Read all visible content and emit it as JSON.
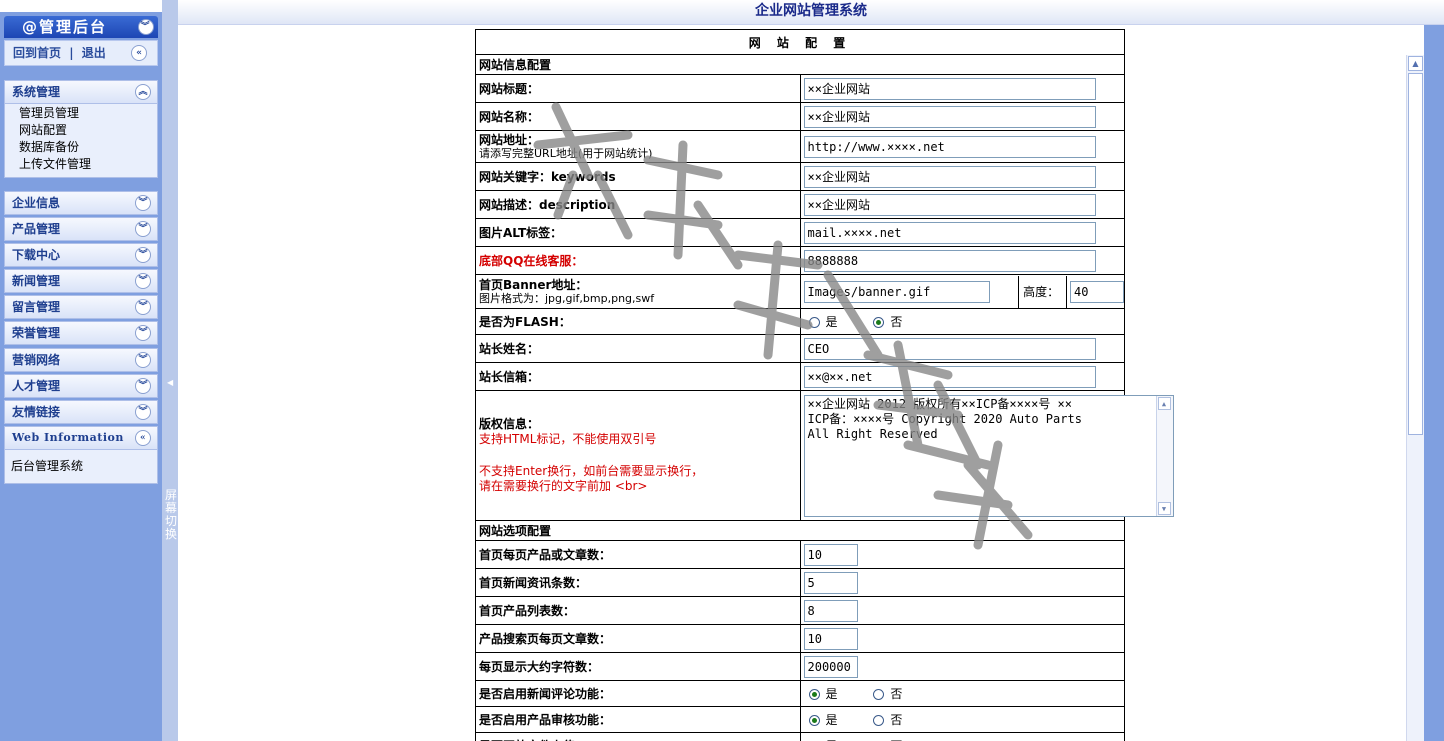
{
  "window": {
    "title": "企业网站管理系统"
  },
  "sidebar": {
    "title": "@管理后台",
    "top_links": [
      "回到首页",
      "|",
      "退出"
    ],
    "system_menu": {
      "label": "系统管理",
      "items": [
        "管理员管理",
        "网站配置",
        "数据库备份",
        "上传文件管理"
      ]
    },
    "menus": [
      "企业信息",
      "产品管理",
      "下载中心",
      "新闻管理",
      "留言管理",
      "荣誉管理",
      "营销网络",
      "人才管理",
      "友情链接"
    ],
    "web_info": {
      "label": "Web Information",
      "text": "后台管理系统"
    },
    "split_toggle": "屏幕切换"
  },
  "config": {
    "header": "网 站 配 置",
    "section_site": "网站信息配置",
    "section_options": "网站选项配置",
    "site_title": {
      "label": "网站标题：",
      "value": "××企业网站"
    },
    "site_name": {
      "label": "网站名称：",
      "value": "××企业网站"
    },
    "site_url": {
      "label": "网站地址：",
      "hint": "请添写完整URL地址(用于网站统计)",
      "value": "http://www.××××.net"
    },
    "keywords": {
      "label": "网站关键字：keywords",
      "value": "××企业网站"
    },
    "description": {
      "label": "网站描述：description",
      "value": "××企业网站"
    },
    "img_alt": {
      "label": "图片ALT标签：",
      "value": "mail.××××.net"
    },
    "qq": {
      "label": "底部QQ在线客服：",
      "value": "8888888"
    },
    "banner": {
      "label": "首页Banner地址：",
      "hint": "图片格式为：jpg,gif,bmp,png,swf",
      "value": "Images/banner.gif",
      "height_label": "高度：",
      "height_value": "40"
    },
    "is_flash": {
      "label": "是否为FLASH：",
      "yes": "是",
      "no": "否"
    },
    "admin_name": {
      "label": "站长姓名：",
      "value": "CEO"
    },
    "admin_email": {
      "label": "站长信箱：",
      "value": "××@××.net"
    },
    "copyright": {
      "label": "版权信息：",
      "hint1": "支持HTML标记，不能使用双引号",
      "hint2": "不支持Enter换行，如前台需要显示换行，",
      "hint3": "请在需要换行的文字前加 <br>",
      "line1": "××企业网站 2012 版权所有××ICP备××××号 ××",
      "line2": "ICP备：××××号 Copyright 2020  Auto Parts",
      "line3": "All Right Reserved"
    },
    "options": [
      {
        "label": "首页每页产品或文章数：",
        "value": "10"
      },
      {
        "label": "首页新闻资讯条数：",
        "value": "5"
      },
      {
        "label": "首页产品列表数：",
        "value": "8"
      },
      {
        "label": "产品搜索页每页文章数：",
        "value": "10"
      },
      {
        "label": "每页显示大约字符数：",
        "value": "200000"
      }
    ],
    "news_comment": {
      "label": "是否启用新闻评论功能：",
      "yes": "是",
      "no": "否"
    },
    "product_review": {
      "label": "是否启用产品审核功能：",
      "yes": "是",
      "no": "否"
    },
    "file_upload": {
      "label": "是否开放文件上传：",
      "yes": "是",
      "no": "否"
    }
  },
  "colors": {
    "accent": "#1d46b4",
    "sidebar_bg": "#7f9fe0",
    "hint_red": "#d40000"
  }
}
